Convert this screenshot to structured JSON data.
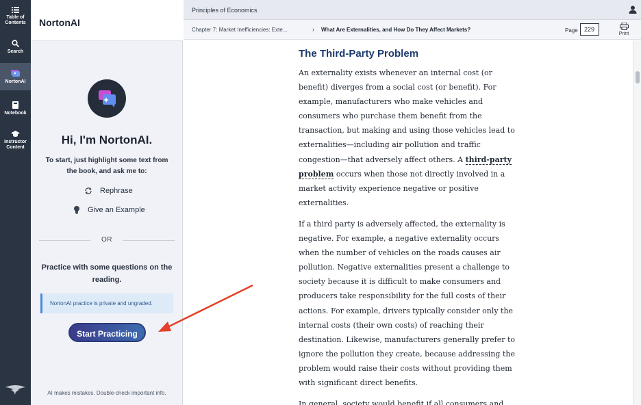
{
  "rail": {
    "items": [
      {
        "label_line1": "Table of",
        "label_line2": "Contents"
      },
      {
        "label_line1": "Search",
        "label_line2": ""
      },
      {
        "label_line1": "NortonAI",
        "label_line2": ""
      },
      {
        "label_line1": "Notebook",
        "label_line2": ""
      },
      {
        "label_line1": "Instructor",
        "label_line2": "Content"
      }
    ]
  },
  "panel": {
    "title": "NortonAI",
    "greeting": "Hi, I'm NortonAI.",
    "intro": "To start, just highlight some text from the book, and ask me to:",
    "actions": [
      {
        "label": "Rephrase",
        "icon": "refresh-icon"
      },
      {
        "label": "Give an Example",
        "icon": "lightbulb-icon"
      }
    ],
    "or_text": "OR",
    "practice_text": "Practice with some questions on the reading.",
    "notice": "NortonAI practice is private and ungraded.",
    "start_button": "Start Practicing",
    "disclaimer": "AI makes mistakes. Double-check important info."
  },
  "reader": {
    "book_title": "Principles of Economics",
    "chapter_crumb": "Chapter 7: Market Inefficiencies: Exte...",
    "crumb_separator": "›",
    "section_crumb": "What Are Externalities, and How Do They Affect Markets?",
    "page_label": "Page",
    "page_value": "229",
    "print_label": "Print",
    "heading": "The Third-Party Problem",
    "p1_a": "An externality exists whenever an internal cost (or benefit) diverges from a social cost (or benefit). For example, manufacturers who make vehicles and consumers who purchase them benefit from the transaction, but making and using those vehicles lead to externalities—including air pollution and traffic congestion—that adversely affect others. A ",
    "p1_term": "third-party problem",
    "p1_b": " occurs when those not directly involved in a market activity experience negative or positive externalities.",
    "p2": "If a third party is adversely affected, the externality is negative. For example, a negative externality occurs when the number of vehicles on the roads causes air pollution. Negative externalities present a challenge to society because it is difficult to make consumers and producers take responsibility for the full costs of their actions. For example, drivers typically consider only the internal costs (their own costs) of reaching their destination. Likewise, manufacturers generally prefer to ignore the pollution they create, because addressing the problem would raise their costs without providing them with significant direct benefits.",
    "p3": "In general, society would benefit if all consumers and"
  },
  "colors": {
    "rail_bg": "#2b3442",
    "heading": "#1b3a6b",
    "button_start": "#3b3a8a",
    "button_end": "#3d6cb0",
    "arrow": "#e5402b"
  }
}
